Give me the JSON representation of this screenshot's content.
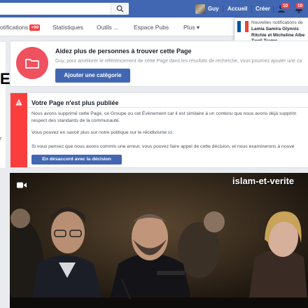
{
  "topbar": {
    "search_placeholder": "",
    "user_name": "Guy",
    "home_label": "Accueil",
    "create_label": "Créer",
    "friend_requests_count": "10",
    "notifications_count": "10"
  },
  "page_nav": {
    "notifications_label": "otifications",
    "notifications_badge": "+99",
    "stats_label": "Statistiques",
    "tools_label": "Outils ...",
    "ads_label": "Espace Pubs",
    "more_label": "Plus ▾"
  },
  "notification_popup": {
    "title": "Nouvelles notifications de",
    "names": "Lamia Samira Glynnis Ritchie et Micheline Albe Tawil Tramp",
    "flag_colors": [
      "#0055a4",
      "#ffffff",
      "#ef4135"
    ]
  },
  "left_column": {
    "big_letter": "E",
    "small_text": "r"
  },
  "category_card": {
    "title": "Aidez plus de personnes à trouver cette Page",
    "description": "Guy, pour améliorer le référencement de cette Page dans les résultats de recherche, vous pourriez ajouter une ca",
    "button_label": "Ajouter une catégorie",
    "icon": "folder-icon",
    "accent_color": "#f0515f"
  },
  "warning_card": {
    "title": "Votre Page n'est plus publiée",
    "line1": "Nous avons supprimé cette Page, ce Groupe ou cet Évènement car il est similaire à un contenu que nous avons déjà supprim",
    "line2": "respect des standards de la communauté.",
    "line3_prefix": "Vous pouvez en savoir plus sur notre politique sur le récidivisme ",
    "line3_link": "ici",
    "line3_suffix": ".",
    "line4": "Si vous pensez que nous avons commis une erreur, vous pouvez faire appel de cette décision, et nous examinerons à nouve",
    "button_label": "En désaccord avec la décision",
    "stripe_color": "#fa3e3e"
  },
  "video": {
    "watermark": "islam-et-verite",
    "icon": "video-camera-icon"
  },
  "colors": {
    "brand_blue": "#4267b2",
    "badge_red": "#fa3e3e",
    "background": "#e9ebee"
  }
}
